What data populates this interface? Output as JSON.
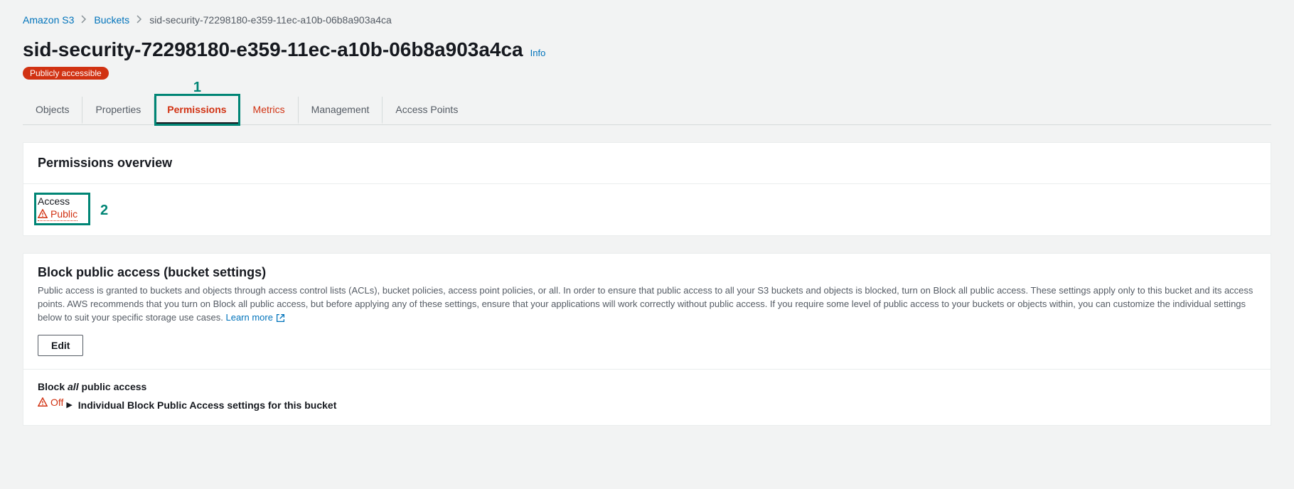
{
  "breadcrumb": {
    "root": "Amazon S3",
    "buckets": "Buckets",
    "current": "sid-security-72298180-e359-11ec-a10b-06b8a903a4ca"
  },
  "heading": {
    "title": "sid-security-72298180-e359-11ec-a10b-06b8a903a4ca",
    "info": "Info",
    "badge": "Publicly accessible"
  },
  "tabs": {
    "objects": "Objects",
    "properties": "Properties",
    "permissions": "Permissions",
    "metrics": "Metrics",
    "management": "Management",
    "accessPoints": "Access Points"
  },
  "overview": {
    "title": "Permissions overview",
    "accessLabel": "Access",
    "accessValue": "Public"
  },
  "bpa": {
    "title": "Block public access (bucket settings)",
    "desc": "Public access is granted to buckets and objects through access control lists (ACLs), bucket policies, access point policies, or all. In order to ensure that public access to all your S3 buckets and objects is blocked, turn on Block all public access. These settings apply only to this bucket and its access points. AWS recommends that you turn on Block all public access, but before applying any of these settings, ensure that your applications will work correctly without public access. If you require some level of public access to your buckets or objects within, you can customize the individual settings below to suit your specific storage use cases.",
    "learnMore": "Learn more",
    "edit": "Edit",
    "blockAllPrefix": "Block ",
    "blockAllEm": "all",
    "blockAllSuffix": " public access",
    "status": "Off",
    "expander": "Individual Block Public Access settings for this bucket"
  },
  "annotations": {
    "one": "1",
    "two": "2"
  }
}
